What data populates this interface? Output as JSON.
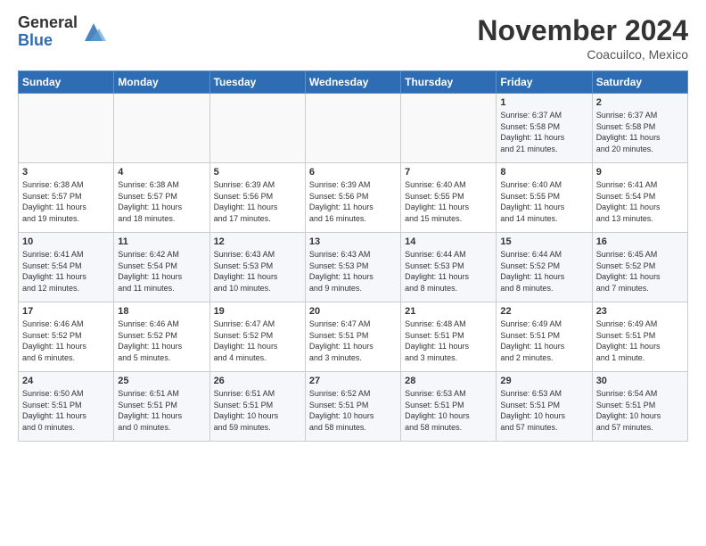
{
  "logo": {
    "general": "General",
    "blue": "Blue"
  },
  "title": "November 2024",
  "location": "Coacuilco, Mexico",
  "weekdays": [
    "Sunday",
    "Monday",
    "Tuesday",
    "Wednesday",
    "Thursday",
    "Friday",
    "Saturday"
  ],
  "weeks": [
    [
      {
        "day": "",
        "info": ""
      },
      {
        "day": "",
        "info": ""
      },
      {
        "day": "",
        "info": ""
      },
      {
        "day": "",
        "info": ""
      },
      {
        "day": "",
        "info": ""
      },
      {
        "day": "1",
        "info": "Sunrise: 6:37 AM\nSunset: 5:58 PM\nDaylight: 11 hours\nand 21 minutes."
      },
      {
        "day": "2",
        "info": "Sunrise: 6:37 AM\nSunset: 5:58 PM\nDaylight: 11 hours\nand 20 minutes."
      }
    ],
    [
      {
        "day": "3",
        "info": "Sunrise: 6:38 AM\nSunset: 5:57 PM\nDaylight: 11 hours\nand 19 minutes."
      },
      {
        "day": "4",
        "info": "Sunrise: 6:38 AM\nSunset: 5:57 PM\nDaylight: 11 hours\nand 18 minutes."
      },
      {
        "day": "5",
        "info": "Sunrise: 6:39 AM\nSunset: 5:56 PM\nDaylight: 11 hours\nand 17 minutes."
      },
      {
        "day": "6",
        "info": "Sunrise: 6:39 AM\nSunset: 5:56 PM\nDaylight: 11 hours\nand 16 minutes."
      },
      {
        "day": "7",
        "info": "Sunrise: 6:40 AM\nSunset: 5:55 PM\nDaylight: 11 hours\nand 15 minutes."
      },
      {
        "day": "8",
        "info": "Sunrise: 6:40 AM\nSunset: 5:55 PM\nDaylight: 11 hours\nand 14 minutes."
      },
      {
        "day": "9",
        "info": "Sunrise: 6:41 AM\nSunset: 5:54 PM\nDaylight: 11 hours\nand 13 minutes."
      }
    ],
    [
      {
        "day": "10",
        "info": "Sunrise: 6:41 AM\nSunset: 5:54 PM\nDaylight: 11 hours\nand 12 minutes."
      },
      {
        "day": "11",
        "info": "Sunrise: 6:42 AM\nSunset: 5:54 PM\nDaylight: 11 hours\nand 11 minutes."
      },
      {
        "day": "12",
        "info": "Sunrise: 6:43 AM\nSunset: 5:53 PM\nDaylight: 11 hours\nand 10 minutes."
      },
      {
        "day": "13",
        "info": "Sunrise: 6:43 AM\nSunset: 5:53 PM\nDaylight: 11 hours\nand 9 minutes."
      },
      {
        "day": "14",
        "info": "Sunrise: 6:44 AM\nSunset: 5:53 PM\nDaylight: 11 hours\nand 8 minutes."
      },
      {
        "day": "15",
        "info": "Sunrise: 6:44 AM\nSunset: 5:52 PM\nDaylight: 11 hours\nand 8 minutes."
      },
      {
        "day": "16",
        "info": "Sunrise: 6:45 AM\nSunset: 5:52 PM\nDaylight: 11 hours\nand 7 minutes."
      }
    ],
    [
      {
        "day": "17",
        "info": "Sunrise: 6:46 AM\nSunset: 5:52 PM\nDaylight: 11 hours\nand 6 minutes."
      },
      {
        "day": "18",
        "info": "Sunrise: 6:46 AM\nSunset: 5:52 PM\nDaylight: 11 hours\nand 5 minutes."
      },
      {
        "day": "19",
        "info": "Sunrise: 6:47 AM\nSunset: 5:52 PM\nDaylight: 11 hours\nand 4 minutes."
      },
      {
        "day": "20",
        "info": "Sunrise: 6:47 AM\nSunset: 5:51 PM\nDaylight: 11 hours\nand 3 minutes."
      },
      {
        "day": "21",
        "info": "Sunrise: 6:48 AM\nSunset: 5:51 PM\nDaylight: 11 hours\nand 3 minutes."
      },
      {
        "day": "22",
        "info": "Sunrise: 6:49 AM\nSunset: 5:51 PM\nDaylight: 11 hours\nand 2 minutes."
      },
      {
        "day": "23",
        "info": "Sunrise: 6:49 AM\nSunset: 5:51 PM\nDaylight: 11 hours\nand 1 minute."
      }
    ],
    [
      {
        "day": "24",
        "info": "Sunrise: 6:50 AM\nSunset: 5:51 PM\nDaylight: 11 hours\nand 0 minutes."
      },
      {
        "day": "25",
        "info": "Sunrise: 6:51 AM\nSunset: 5:51 PM\nDaylight: 11 hours\nand 0 minutes."
      },
      {
        "day": "26",
        "info": "Sunrise: 6:51 AM\nSunset: 5:51 PM\nDaylight: 10 hours\nand 59 minutes."
      },
      {
        "day": "27",
        "info": "Sunrise: 6:52 AM\nSunset: 5:51 PM\nDaylight: 10 hours\nand 58 minutes."
      },
      {
        "day": "28",
        "info": "Sunrise: 6:53 AM\nSunset: 5:51 PM\nDaylight: 10 hours\nand 58 minutes."
      },
      {
        "day": "29",
        "info": "Sunrise: 6:53 AM\nSunset: 5:51 PM\nDaylight: 10 hours\nand 57 minutes."
      },
      {
        "day": "30",
        "info": "Sunrise: 6:54 AM\nSunset: 5:51 PM\nDaylight: 10 hours\nand 57 minutes."
      }
    ]
  ]
}
